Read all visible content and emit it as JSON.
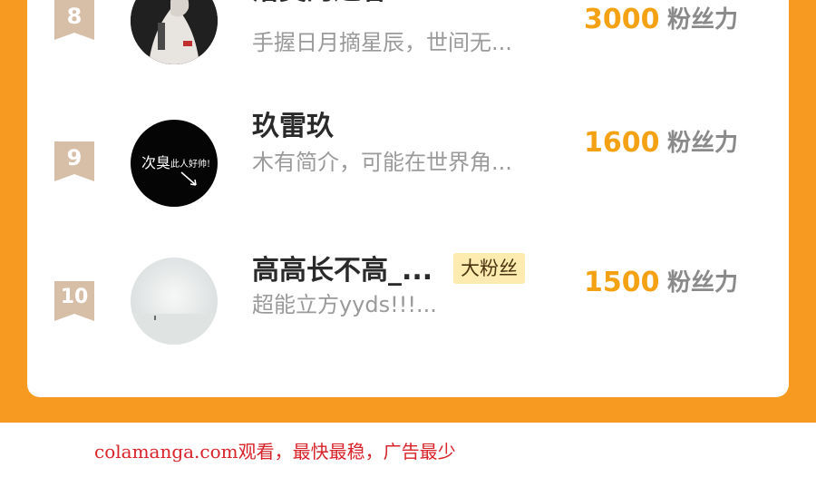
{
  "ranking": {
    "rows": [
      {
        "rank": "8",
        "name": "洛莫的过客",
        "desc": "手握日月摘星辰，世间无...",
        "fans": "3000",
        "unit": "粉丝力",
        "avatar": "avatar-dark-photo"
      },
      {
        "rank": "9",
        "name": "玖雷玖",
        "desc": "木有简介，可能在世界角...",
        "fans": "1600",
        "unit": "粉丝力",
        "avatar": "avatar-black-text"
      },
      {
        "rank": "10",
        "name": "高高长不高_...",
        "badge": "大粉丝",
        "desc": "超能立方yyds!!!...",
        "fans": "1500",
        "unit": "粉丝力",
        "avatar": "avatar-mist-landscape"
      }
    ],
    "avatar2_text_a": "次臭",
    "avatar2_text_b": "此人好帅!"
  },
  "footer": {
    "watermark": "colamanga.com观看，最快最稳，广告最少"
  },
  "colors": {
    "accent_orange": "#f79a22",
    "fans_orange": "#f4a214",
    "badge_bg": "#fdebb0",
    "rank_badge": "#d6bea7",
    "footer_red": "#d8232a"
  }
}
